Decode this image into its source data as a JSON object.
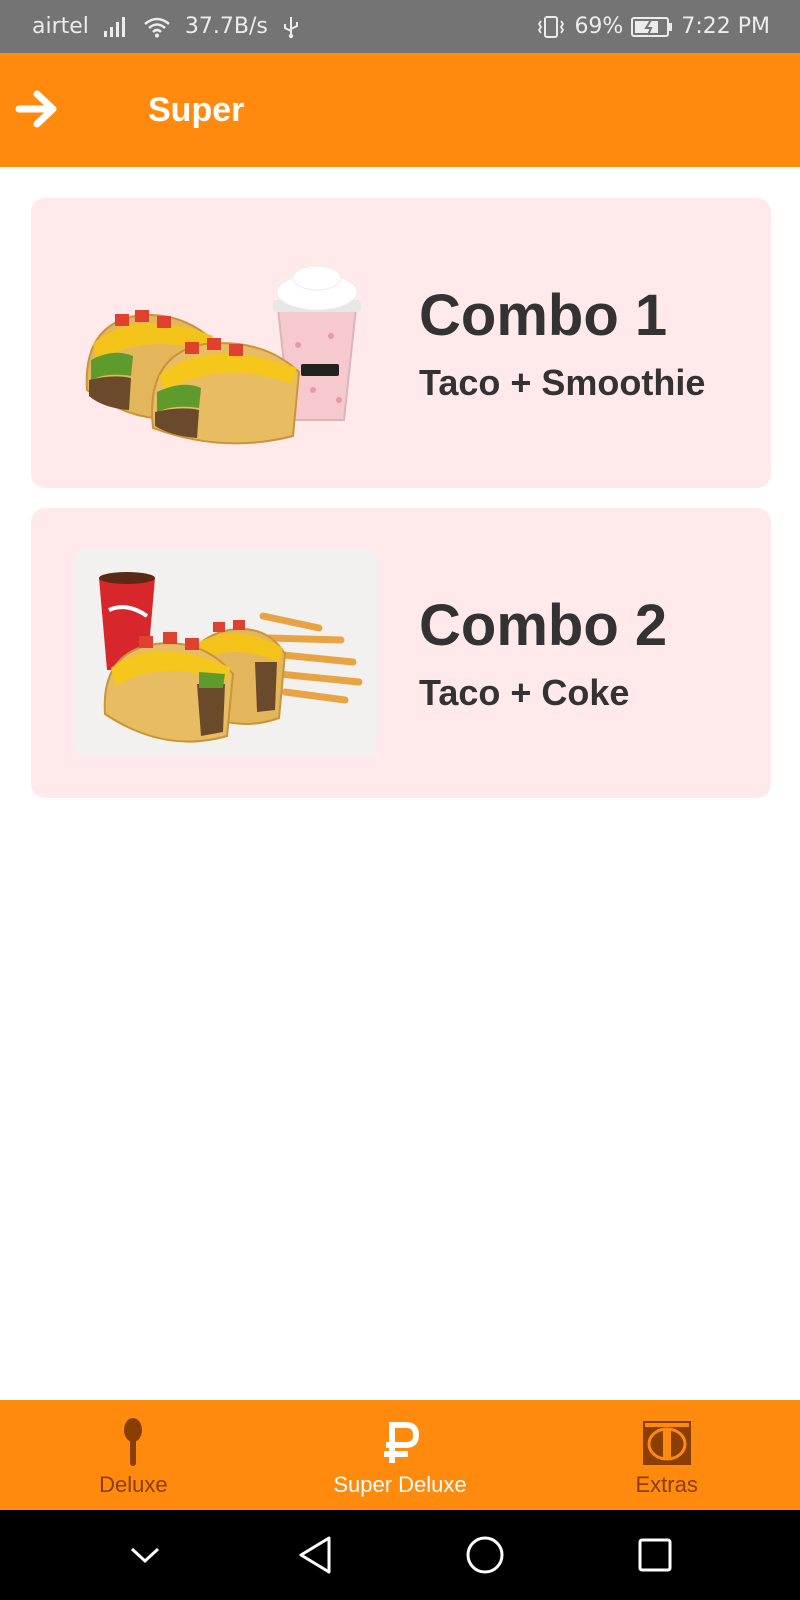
{
  "status_bar": {
    "carrier": "airtel",
    "speed": "37.7B/s",
    "battery": "69%",
    "time": "7:22 PM",
    "icons": [
      "signal-icon",
      "wifi-icon",
      "usb-icon",
      "vibrate-icon",
      "battery-icon"
    ]
  },
  "header": {
    "title": "Super",
    "back_icon": "arrow-right-icon"
  },
  "cards": [
    {
      "title": "Combo 1",
      "subtitle": "Taco + Smoothie",
      "image": "taco-smoothie-image"
    },
    {
      "title": "Combo 2",
      "subtitle": "Taco + Coke",
      "image": "taco-coke-fries-image"
    }
  ],
  "bottom_nav": {
    "items": [
      {
        "label": "Deluxe",
        "icon": "spoon-icon",
        "active": false
      },
      {
        "label": "Super Deluxe",
        "icon": "ruble-icon",
        "active": true
      },
      {
        "label": "Extras",
        "icon": "coin-icon",
        "active": false
      }
    ]
  },
  "system_nav": {
    "icons": [
      "chevron-down-icon",
      "back-triangle-icon",
      "home-circle-icon",
      "recents-square-icon"
    ]
  },
  "colors": {
    "primary": "#ff8a0e",
    "card_bg": "#ffe9ea",
    "text_dark": "#333333",
    "nav_inactive": "#8a3f00",
    "status_bar": "#747474"
  }
}
